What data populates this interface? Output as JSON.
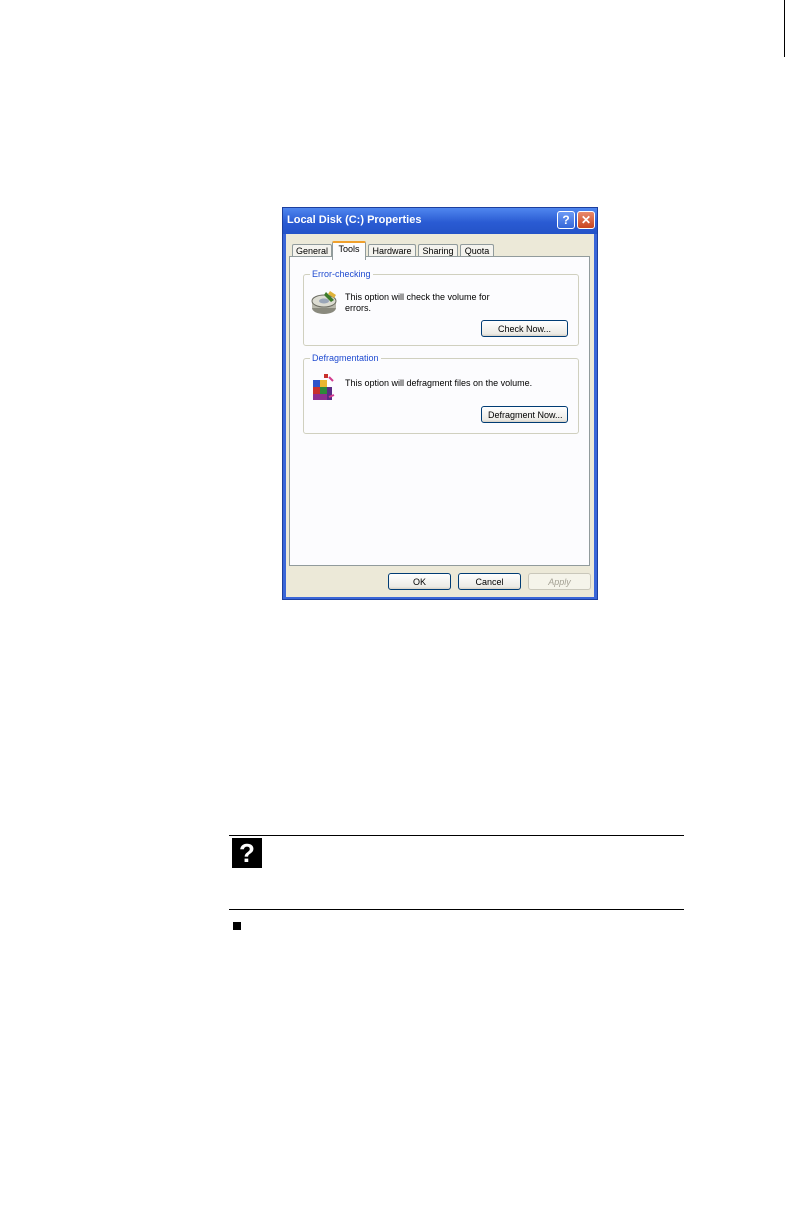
{
  "dialog": {
    "title": "Local Disk (C:) Properties",
    "help_glyph": "?",
    "close_glyph": "✕",
    "tabs": [
      {
        "label": "General",
        "active": false
      },
      {
        "label": "Tools",
        "active": true
      },
      {
        "label": "Hardware",
        "active": false
      },
      {
        "label": "Sharing",
        "active": false
      },
      {
        "label": "Quota",
        "active": false
      }
    ],
    "error_checking": {
      "title": "Error-checking",
      "text": "This option will check the volume for errors.",
      "button": "Check Now..."
    },
    "defragmentation": {
      "title": "Defragmentation",
      "text": "This option will defragment files on the volume.",
      "button": "Defragment Now..."
    },
    "buttons": {
      "ok": "OK",
      "cancel": "Cancel",
      "apply": "Apply"
    }
  },
  "callout": {
    "icon_glyph": "?",
    "icon": "help-icon",
    "bullet_icon": "square-bullet-icon"
  }
}
